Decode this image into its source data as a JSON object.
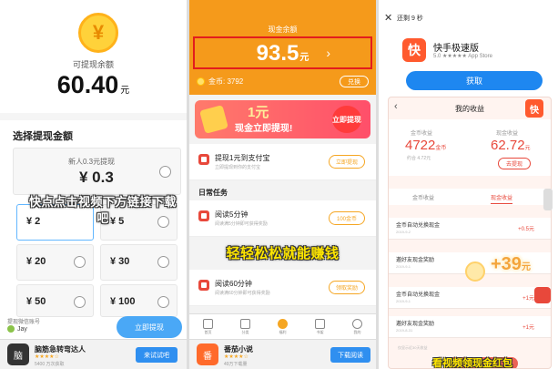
{
  "panel1": {
    "coin_symbol": "¥",
    "balance_label": "可提现余额",
    "balance_value": "60.40",
    "balance_unit": "元",
    "section_title": "选择提现金额",
    "options": [
      {
        "note": "新人0.3元提现",
        "value": "¥ 0.3"
      },
      {
        "value": "¥ 2"
      },
      {
        "value": "¥ 5"
      },
      {
        "value": "¥ 20"
      },
      {
        "value": "¥ 30"
      },
      {
        "value": "¥ 50"
      },
      {
        "value": "¥ 100"
      }
    ],
    "overlay_text": "快点点击视频下方链接下载吧",
    "withdraw_account_label": "提现微信账号",
    "user_name": "Jay",
    "withdraw_button": "立即提现",
    "ad": {
      "icon_text": "脑",
      "name": "脑筋急转弯达人",
      "stars": "★★★★☆",
      "sub": "5400 万次获取",
      "button": "来试试吧"
    }
  },
  "panel2": {
    "title": "现金余额",
    "amount": "93.5",
    "amount_unit": "元",
    "chevron": "›",
    "coins_label": "金币: 3792",
    "redeem_button": "兑换",
    "banner": {
      "big": "1元",
      "sub": "现金立即提现!",
      "bubble": "立即提现"
    },
    "first_task": {
      "title": "提现1元到支付宝",
      "desc": "立即提现到你的支付宝",
      "button": "立即提现"
    },
    "daily_title": "日常任务",
    "tasks": [
      {
        "title": "阅读5分钟",
        "desc": "阅读满5分钟即可获得奖励",
        "button": "100金币"
      },
      {
        "title": "阅读60分钟",
        "desc": "阅读满60分钟即可获得奖励",
        "button": "领取奖励"
      }
    ],
    "overlay_text": "轻轻松松就能赚钱",
    "nav": [
      "首页",
      "分类",
      "福利",
      "书架",
      "我的"
    ],
    "ad": {
      "icon_text": "番",
      "name": "番茄小说",
      "stars": "★★★★☆",
      "sub": "49万下载量",
      "button": "下载阅读"
    }
  },
  "panel3": {
    "close_label": "还剩 9 秒",
    "app_icon_text": "快",
    "app_name": "快手极速版",
    "app_rating": "5.0 ★★★★★ App Store",
    "get_button": "获取",
    "inner_title": "我的收益",
    "badge_text": "快",
    "coins_label": "金币收益",
    "coins_value": "4722",
    "coins_unit": "金币",
    "coins_sub": "约合 4.72元",
    "cash_label": "现金收益",
    "cash_value": "62.72",
    "cash_unit": "元",
    "withdraw_button": "去提现",
    "tabs": [
      "金币收益",
      "现金收益"
    ],
    "records": [
      {
        "title": "金币自动兑换现金",
        "date": "2019-9-2",
        "amount": "+0.5元"
      },
      {
        "title": "邀好友现金奖励",
        "date": "2019-9-1",
        "amount": ""
      },
      {
        "title": "金币自动兑换现金",
        "date": "2019-9-1",
        "amount": "+1元"
      },
      {
        "title": "邀好友现金奖励",
        "date": "2019-8-31",
        "amount": "+1元"
      }
    ],
    "big_plus": "+39",
    "big_plus_unit": "元",
    "foot_date": "仅显示近30天收益",
    "overlay_text": "看视频领现金红包"
  }
}
